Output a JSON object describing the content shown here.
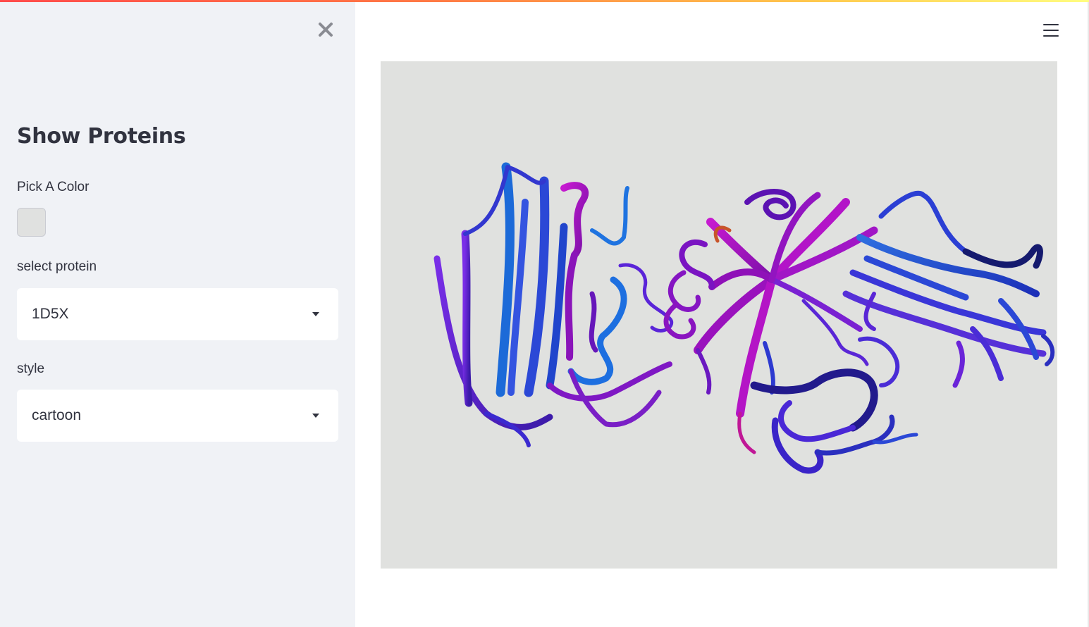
{
  "sidebar": {
    "title": "Show Proteins",
    "color_picker": {
      "label": "Pick A Color",
      "value": "#e0e1e0"
    },
    "protein_select": {
      "label": "select protein",
      "value": "1D5X"
    },
    "style_select": {
      "label": "style",
      "value": "cartoon"
    }
  },
  "icons": {
    "close": "close-icon",
    "menu": "hamburger-menu-icon",
    "dropdown": "caret-down-icon"
  },
  "colors": {
    "sidebar_bg": "#f0f2f6",
    "viewer_bg": "#e0e1df",
    "ribbon_blue": "#2a55d8",
    "ribbon_violet": "#6a1fd6",
    "ribbon_magenta": "#b312c9"
  }
}
